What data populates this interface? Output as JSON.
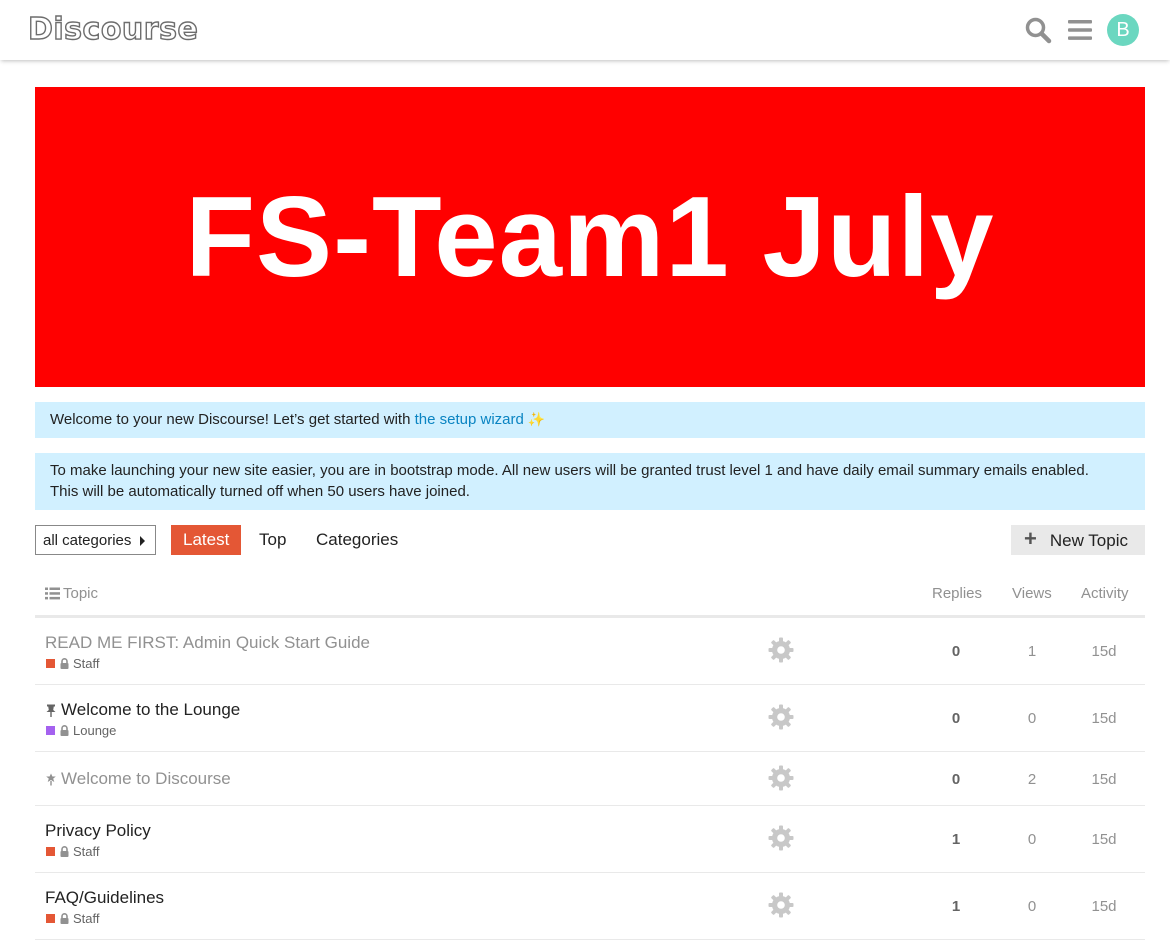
{
  "header": {
    "logo_text": "Discourse",
    "avatar_letter": "B",
    "icons": [
      "search-icon",
      "hamburger-menu-icon"
    ],
    "avatar_color": "#6bd7c0"
  },
  "banner": {
    "title": "FS-Team1 July",
    "background_color": "#ff0000"
  },
  "notices": {
    "wizard_prefix": "Welcome to your new Discourse! Let’s get started with ",
    "wizard_link": "the setup wizard",
    "wizard_icon": "sparkles-icon",
    "bootstrap_line1": "To make launching your new site easier, you are in bootstrap mode. All new users will be granted trust level 1 and have daily email summary emails enabled.",
    "bootstrap_line2": "This will be automatically turned off when 50 users have joined."
  },
  "nav": {
    "category_dropdown": "all categories",
    "tabs": [
      {
        "label": "Latest",
        "active": true
      },
      {
        "label": "Top",
        "active": false
      },
      {
        "label": "Categories",
        "active": false
      }
    ],
    "new_topic": "New Topic",
    "accent_color": "#e45735"
  },
  "table": {
    "headers": {
      "topic": "Topic",
      "replies": "Replies",
      "views": "Views",
      "activity": "Activity"
    },
    "rows": [
      {
        "title": "READ ME FIRST: Admin Quick Start Guide",
        "visited": true,
        "icon": null,
        "category": "Staff",
        "category_color": "#e45735",
        "replies": "0",
        "views": "1",
        "activity": "15d"
      },
      {
        "title": "Welcome to the Lounge",
        "visited": false,
        "icon": "pin-icon",
        "category": "Lounge",
        "category_color": "#a461ef",
        "replies": "0",
        "views": "0",
        "activity": "15d"
      },
      {
        "title": "Welcome to Discourse",
        "visited": true,
        "icon": "globe-pin-icon",
        "category": null,
        "category_color": null,
        "replies": "0",
        "views": "2",
        "activity": "15d"
      },
      {
        "title": "Privacy Policy",
        "visited": false,
        "icon": null,
        "category": "Staff",
        "category_color": "#e45735",
        "replies": "1",
        "views": "0",
        "activity": "15d"
      },
      {
        "title": "FAQ/Guidelines",
        "visited": false,
        "icon": null,
        "category": "Staff",
        "category_color": "#e45735",
        "replies": "1",
        "views": "0",
        "activity": "15d"
      }
    ]
  }
}
